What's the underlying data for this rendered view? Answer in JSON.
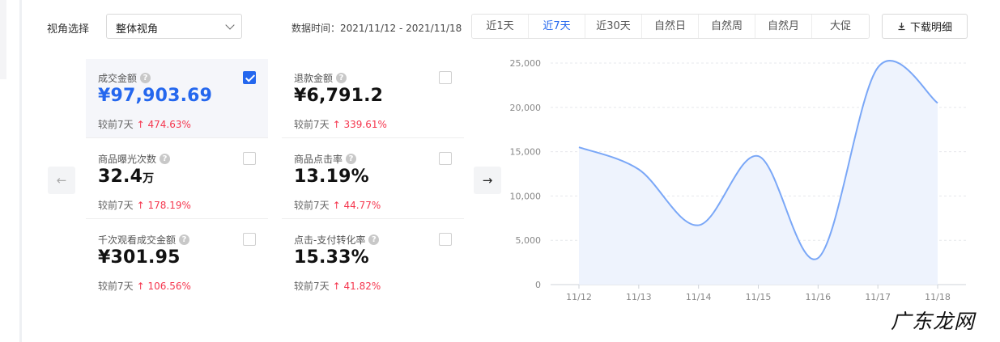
{
  "filter": {
    "view_label": "视角选择",
    "view_value": "整体视角",
    "data_time": "数据时间：2021/11/12 - 2021/11/18",
    "ranges": [
      "近1天",
      "近7天",
      "近30天",
      "自然日",
      "自然周",
      "自然月",
      "大促"
    ],
    "active_range": "近7天",
    "download_label": "下载明细"
  },
  "nav": {
    "prev_icon": "arrow-left-icon",
    "next_icon": "arrow-right-icon"
  },
  "metrics": [
    {
      "title": "成交金额",
      "value": "¥97,903.69",
      "unit": "",
      "compare_label": "较前7天",
      "change": "474.63%",
      "checked": true
    },
    {
      "title": "退款金额",
      "value": "¥6,791.2",
      "unit": "",
      "compare_label": "较前7天",
      "change": "339.61%",
      "checked": false
    },
    {
      "title": "商品曝光次数",
      "value": "32.4",
      "unit": "万",
      "compare_label": "较前7天",
      "change": "178.19%",
      "checked": false
    },
    {
      "title": "商品点击率",
      "value": "13.19%",
      "unit": "",
      "compare_label": "较前7天",
      "change": "44.77%",
      "checked": false
    },
    {
      "title": "千次观看成交金额",
      "value": "¥301.95",
      "unit": "",
      "compare_label": "较前7天",
      "change": "106.56%",
      "checked": false
    },
    {
      "title": "点击-支付转化率",
      "value": "15.33%",
      "unit": "",
      "compare_label": "较前7天",
      "change": "41.82%",
      "checked": false
    }
  ],
  "chart_data": {
    "type": "line",
    "x": [
      "11/12",
      "11/13",
      "11/14",
      "11/15",
      "11/16",
      "11/17",
      "11/18"
    ],
    "series": [
      {
        "values": [
          15500,
          13000,
          6700,
          14500,
          3000,
          24500,
          20500
        ]
      }
    ],
    "yticks": [
      "0",
      "5,000",
      "10,000",
      "15,000",
      "20,000",
      "25,000"
    ],
    "ylim": [
      0,
      25000
    ],
    "grid": true,
    "line_color": "#7aa7f7",
    "fill_color": "#eef3fd"
  },
  "watermark": "广东龙网"
}
